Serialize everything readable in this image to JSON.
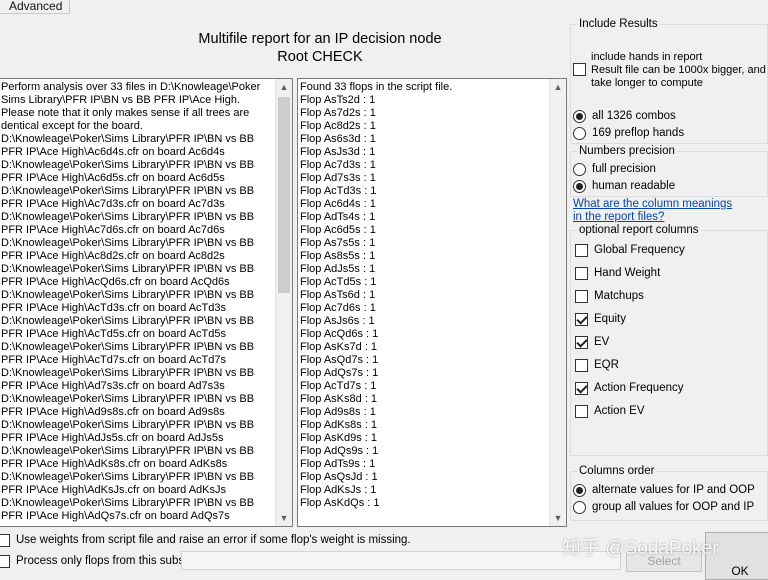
{
  "tab": {
    "label": "Advanced"
  },
  "title": {
    "line1": "Multifile report for an IP decision node",
    "line2": "Root CHECK"
  },
  "left_log": [
    "Perform analysis over 33 files in D:\\Knowleage\\Poker",
    "Sims Library\\PFR IP\\BN vs BB PFR IP\\Ace High.",
    "Please note that it only makes sense if all trees are",
    "dentical except for the board.",
    "D:\\Knowleage\\Poker\\Sims Library\\PFR IP\\BN vs BB",
    "PFR IP\\Ace High\\Ac6d4s.cfr on board Ac6d4s",
    "D:\\Knowleage\\Poker\\Sims Library\\PFR IP\\BN vs BB",
    "PFR IP\\Ace High\\Ac6d5s.cfr on board Ac6d5s",
    "D:\\Knowleage\\Poker\\Sims Library\\PFR IP\\BN vs BB",
    "PFR IP\\Ace High\\Ac7d3s.cfr on board Ac7d3s",
    "D:\\Knowleage\\Poker\\Sims Library\\PFR IP\\BN vs BB",
    "PFR IP\\Ace High\\Ac7d6s.cfr on board Ac7d6s",
    "D:\\Knowleage\\Poker\\Sims Library\\PFR IP\\BN vs BB",
    "PFR IP\\Ace High\\Ac8d2s.cfr on board Ac8d2s",
    "D:\\Knowleage\\Poker\\Sims Library\\PFR IP\\BN vs BB",
    "PFR IP\\Ace High\\AcQd6s.cfr on board AcQd6s",
    "D:\\Knowleage\\Poker\\Sims Library\\PFR IP\\BN vs BB",
    "PFR IP\\Ace High\\AcTd3s.cfr on board AcTd3s",
    "D:\\Knowleage\\Poker\\Sims Library\\PFR IP\\BN vs BB",
    "PFR IP\\Ace High\\AcTd5s.cfr on board AcTd5s",
    "D:\\Knowleage\\Poker\\Sims Library\\PFR IP\\BN vs BB",
    "PFR IP\\Ace High\\AcTd7s.cfr on board AcTd7s",
    "D:\\Knowleage\\Poker\\Sims Library\\PFR IP\\BN vs BB",
    "PFR IP\\Ace High\\Ad7s3s.cfr on board Ad7s3s",
    "D:\\Knowleage\\Poker\\Sims Library\\PFR IP\\BN vs BB",
    "PFR IP\\Ace High\\Ad9s8s.cfr on board Ad9s8s",
    "D:\\Knowleage\\Poker\\Sims Library\\PFR IP\\BN vs BB",
    "PFR IP\\Ace High\\AdJs5s.cfr on board AdJs5s",
    "D:\\Knowleage\\Poker\\Sims Library\\PFR IP\\BN vs BB",
    "PFR IP\\Ace High\\AdKs8s.cfr on board AdKs8s",
    "D:\\Knowleage\\Poker\\Sims Library\\PFR IP\\BN vs BB",
    "PFR IP\\Ace High\\AdKsJs.cfr on board AdKsJs",
    "D:\\Knowleage\\Poker\\Sims Library\\PFR IP\\BN vs BB",
    "PFR IP\\Ace High\\AdQs7s.cfr on board AdQs7s"
  ],
  "right_log": [
    "Found 33 flops in the script file.",
    "Flop AsTs2d : 1",
    "Flop As7d2s : 1",
    "Flop Ac8d2s : 1",
    "Flop As6s3d : 1",
    "Flop AsJs3d : 1",
    "Flop Ac7d3s : 1",
    "Flop Ad7s3s : 1",
    "Flop AcTd3s : 1",
    "Flop Ac6d4s : 1",
    "Flop AdTs4s : 1",
    "Flop Ac6d5s : 1",
    "Flop As7s5s : 1",
    "Flop As8s5s : 1",
    "Flop AdJs5s : 1",
    "Flop AcTd5s : 1",
    "Flop AsTs6d : 1",
    "Flop Ac7d6s : 1",
    "Flop AsJs6s : 1",
    "Flop AcQd6s : 1",
    "Flop AsKs7d : 1",
    "Flop AsQd7s : 1",
    "Flop AdQs7s : 1",
    "Flop AcTd7s : 1",
    "Flop AsKs8d : 1",
    "Flop Ad9s8s : 1",
    "Flop AdKs8s : 1",
    "Flop AsKd9s : 1",
    "Flop AdQs9s : 1",
    "Flop AdTs9s : 1",
    "Flop AsQsJd : 1",
    "Flop AdKsJs : 1",
    "Flop AsKdQs : 1"
  ],
  "include_results": {
    "title": "Include Results",
    "include_hands_label": [
      "include hands in report",
      "Result file can be 1000x bigger, and",
      "take longer to compute"
    ],
    "include_hands_checked": false,
    "all_combos_label": "all 1326 combos",
    "preflop_hands_label": "169 preflop hands",
    "selected": "all_combos"
  },
  "numbers_precision": {
    "title": "Numbers precision",
    "full_label": "full precision",
    "human_label": "human readable",
    "selected": "human"
  },
  "column_meanings_link": [
    "What are the column meanings",
    "in the report files?"
  ],
  "optional_columns": {
    "title": "optional report columns",
    "items": [
      {
        "label": "Global Frequency",
        "checked": false
      },
      {
        "label": "Hand Weight",
        "checked": false
      },
      {
        "label": "Matchups",
        "checked": false
      },
      {
        "label": "Equity",
        "checked": true
      },
      {
        "label": "EV",
        "checked": true
      },
      {
        "label": "EQR",
        "checked": false
      },
      {
        "label": "Action Frequency",
        "checked": true
      },
      {
        "label": "Action EV",
        "checked": false
      }
    ]
  },
  "columns_order": {
    "title": "Columns order",
    "alternate_label": "alternate values for IP and OOP",
    "group_label": "group all values for OOP and IP",
    "selected": "alternate"
  },
  "bottom": {
    "use_weights_label": "Use weights from script file and raise an error if some flop's weight is missing.",
    "use_weights_checked": false,
    "process_subset_label": "Process only flops from this subset",
    "process_subset_checked": false,
    "subset_value": "",
    "select_button": "Select",
    "ok_button": "OK"
  },
  "watermark": "知乎 @SodaPoker"
}
